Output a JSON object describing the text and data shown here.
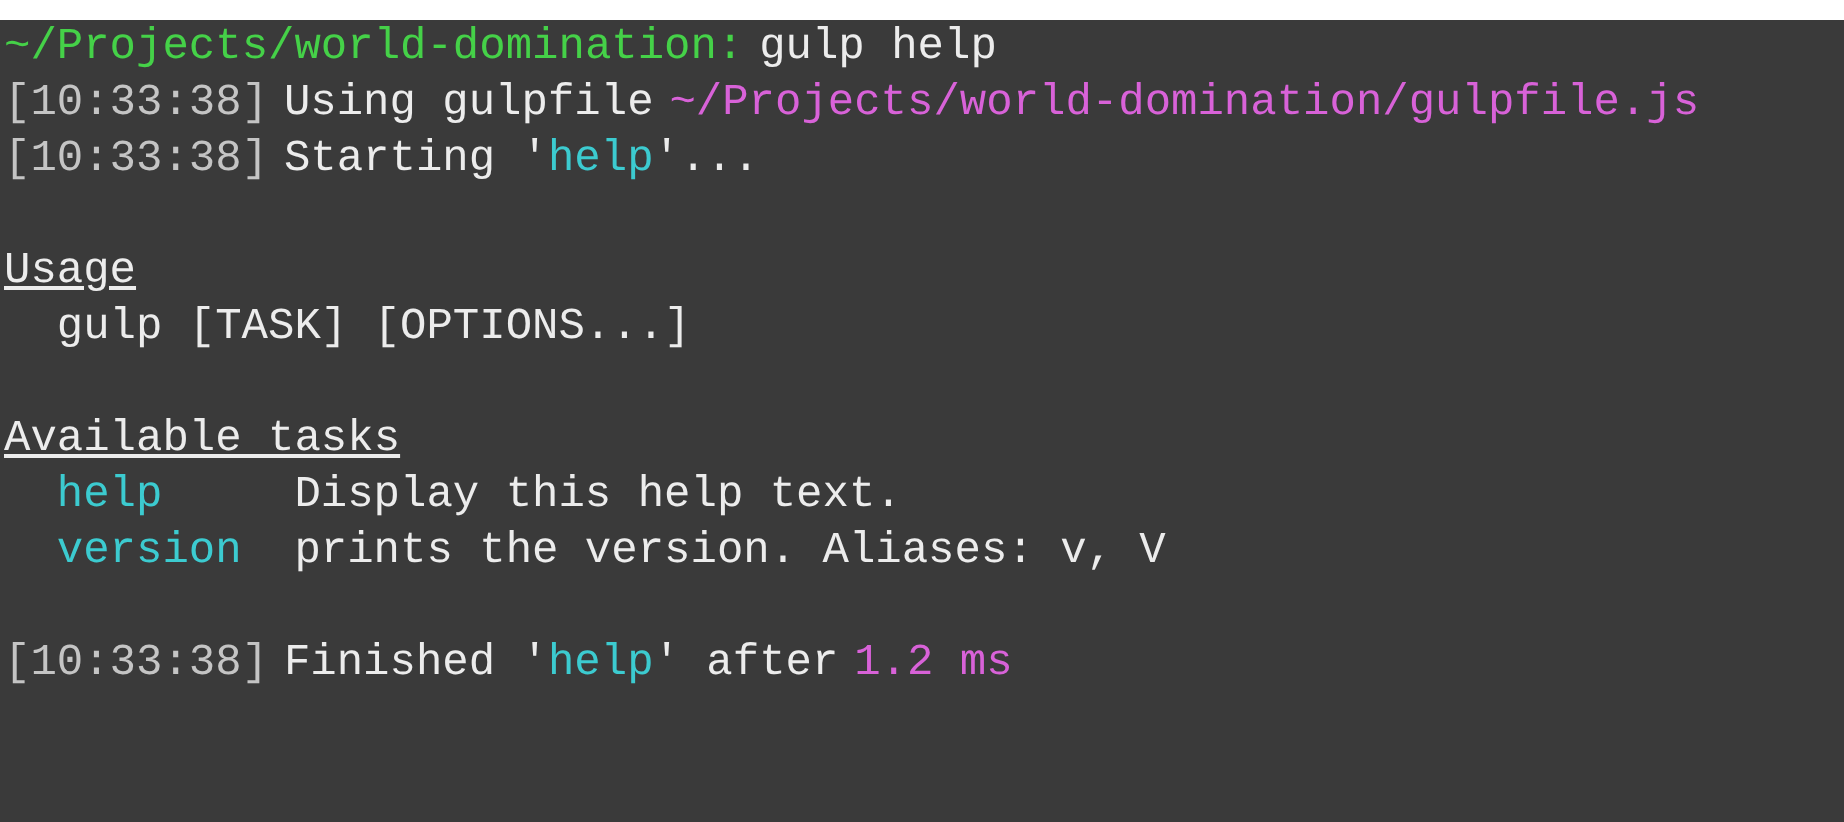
{
  "terminal": {
    "lines": [
      {
        "kind": "plain",
        "segments": [
          {
            "kind": "prompt",
            "text": "~/Projects/world-domination:"
          },
          {
            "kind": "text",
            "text": "gulp help"
          }
        ]
      },
      {
        "kind": "plain",
        "segments": [
          {
            "kind": "timestamp",
            "text": "[10:33:38]"
          },
          {
            "kind": "text",
            "text": "Using gulpfile"
          },
          {
            "kind": "path",
            "text": "~/Projects/world-domination/gulpfile.js"
          }
        ]
      },
      {
        "kind": "plain",
        "segments": [
          {
            "kind": "timestamp",
            "text": "[10:33:38]"
          },
          {
            "kind": "text",
            "text": "Starting '"
          },
          {
            "kind": "task",
            "text": "help"
          },
          {
            "kind": "glue",
            "text": "'..."
          }
        ]
      },
      {
        "kind": "blank"
      },
      {
        "kind": "plain",
        "segments": [
          {
            "kind": "heading",
            "text": "Usage"
          }
        ]
      },
      {
        "kind": "indented",
        "segments": [
          {
            "kind": "text",
            "text": "gulp [TASK] [OPTIONS...]"
          }
        ]
      },
      {
        "kind": "blank"
      },
      {
        "kind": "plain",
        "segments": [
          {
            "kind": "heading",
            "text": "Available tasks"
          }
        ]
      },
      {
        "kind": "indented",
        "segments": [
          {
            "kind": "taskname",
            "text": "help"
          },
          {
            "kind": "text",
            "text": "Display this help text."
          }
        ]
      },
      {
        "kind": "indented",
        "segments": [
          {
            "kind": "taskname",
            "text": "version"
          },
          {
            "kind": "text",
            "text": "prints the version. Aliases: v, V"
          }
        ]
      },
      {
        "kind": "blank"
      },
      {
        "kind": "plain",
        "segments": [
          {
            "kind": "timestamp",
            "text": "[10:33:38]"
          },
          {
            "kind": "text",
            "text": "Finished '"
          },
          {
            "kind": "task",
            "text": "help"
          },
          {
            "kind": "glue",
            "text": "' after"
          },
          {
            "kind": "number",
            "text": "1.2 ms"
          }
        ]
      }
    ]
  }
}
